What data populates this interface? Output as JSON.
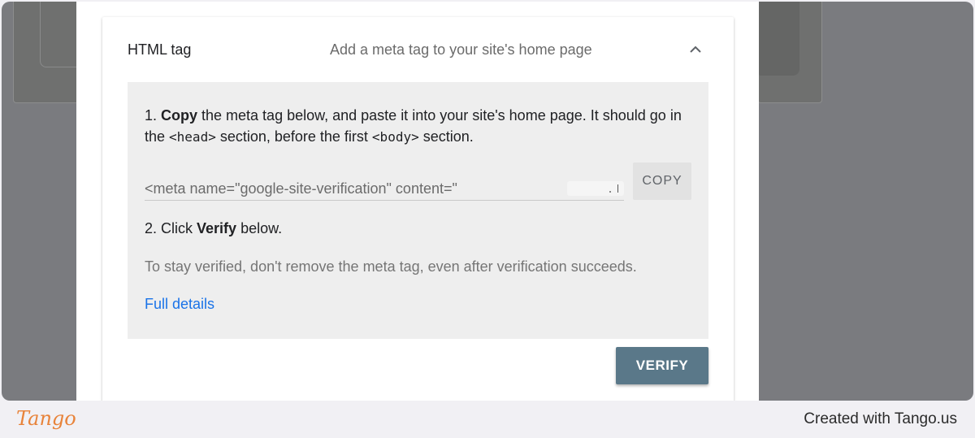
{
  "panel": {
    "title": "HTML tag",
    "description": "Add a meta tag to your site's home page",
    "collapse_icon": "chevron-up-icon"
  },
  "instructions": {
    "step1_prefix": "1. ",
    "step1_bold": "Copy",
    "step1_text_a": " the meta tag below, and paste it into your site's home page. It should go in the ",
    "step1_code_head": "<head>",
    "step1_text_b": " section, before the first ",
    "step1_code_body": "<body>",
    "step1_text_c": " section.",
    "meta_tag_value": "<meta name=\"google-site-verification\" content=\"",
    "copy_label": "COPY",
    "step2_prefix": "2. Click ",
    "step2_bold": "Verify",
    "step2_suffix": " below.",
    "note": "To stay verified, don't remove the meta tag, even after verification succeeds.",
    "details_link": "Full details"
  },
  "actions": {
    "verify_label": "VERIFY"
  },
  "footer": {
    "logo": "Tango",
    "created_with": "Created with Tango.us"
  },
  "colors": {
    "verify_button": "#5a7889",
    "link": "#1a73e8",
    "logo": "#e8833a"
  }
}
